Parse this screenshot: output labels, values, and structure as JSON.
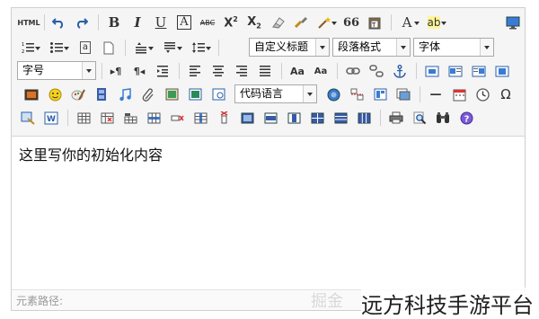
{
  "toolbar": {
    "row1": {
      "html_label": "HTML",
      "bold": "B",
      "italic": "I",
      "underline": "U",
      "fontborder": "A",
      "strike": "ABC",
      "superscript_base": "X",
      "superscript_exp": "2",
      "subscript_base": "X",
      "subscript_exp": "2",
      "blockquote": "66",
      "forecolor": "A",
      "backcolor": "ab"
    },
    "row2": {
      "customstyle": "自定义标题",
      "paragraph": "段落格式",
      "fontfamily": "字体",
      "insertcode_letter": "a"
    },
    "row3": {
      "fontsize": "字号",
      "ltr": "▸¶",
      "rtl": "¶◂",
      "font_up": "Aa",
      "font_down": "Aa"
    },
    "row4": {
      "codelang": "代码语言",
      "horizontal": "—",
      "special_chars": "Ω"
    }
  },
  "editor": {
    "content": "这里写你的初始化内容"
  },
  "statusbar": {
    "path_label": "元素路径:"
  },
  "watermark": {
    "faint": "掘金",
    "text": "远方科技手游平台"
  }
}
